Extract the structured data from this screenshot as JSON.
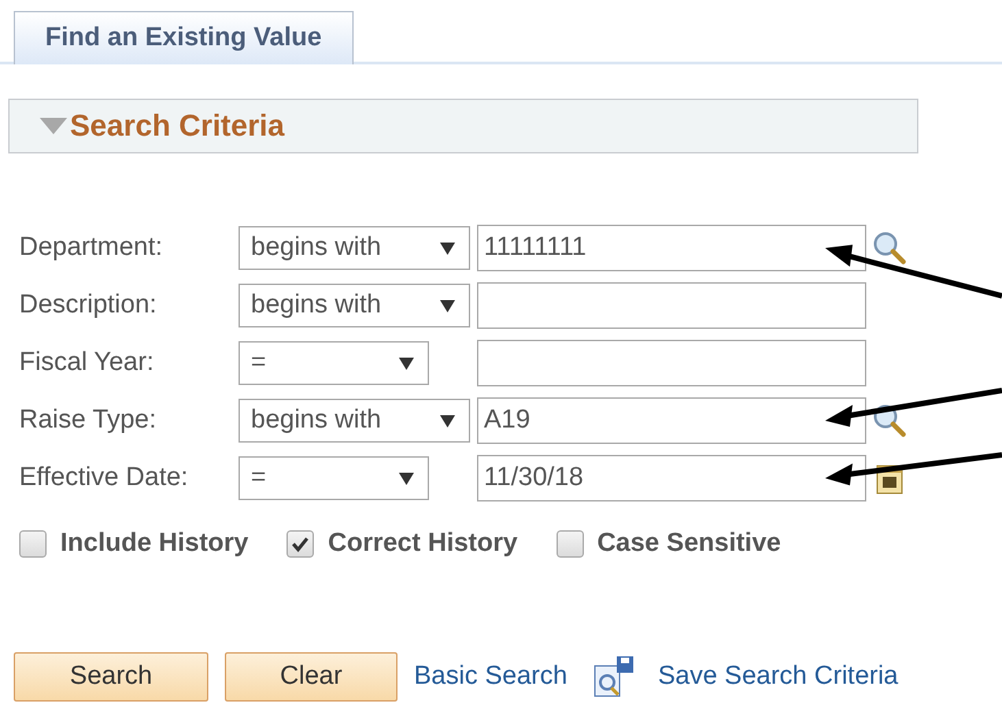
{
  "tabs": [
    {
      "label": "Find an Existing Value",
      "selected": true
    }
  ],
  "section": {
    "title": "Search Criteria",
    "expanded": true
  },
  "fields": [
    {
      "kind": "lookup",
      "label": "Department:",
      "operator": "begins with",
      "value": "11111111",
      "arrow": true
    },
    {
      "kind": "text",
      "label": "Description:",
      "operator": "begins with",
      "arrow": false
    },
    {
      "kind": "number",
      "label": "Fiscal Year:",
      "operator": "=",
      "arrow": false
    },
    {
      "kind": "lookup",
      "label": "Raise Type:",
      "operator": "begins with",
      "value": "A19",
      "arrow": true
    },
    {
      "kind": "date",
      "label": "Effective Date:",
      "operator": "=",
      "value": "11/30/18",
      "arrow": true
    }
  ],
  "options": [
    {
      "label": "Include History",
      "checked": false
    },
    {
      "label": "Correct History",
      "checked": true
    },
    {
      "label": "Case Sensitive",
      "checked": false
    }
  ],
  "buttons": [
    "Search",
    "Clear"
  ],
  "links": [
    {
      "label": "Basic Search",
      "icon": false
    },
    {
      "label": "Save Search Criteria",
      "icon": true
    }
  ]
}
